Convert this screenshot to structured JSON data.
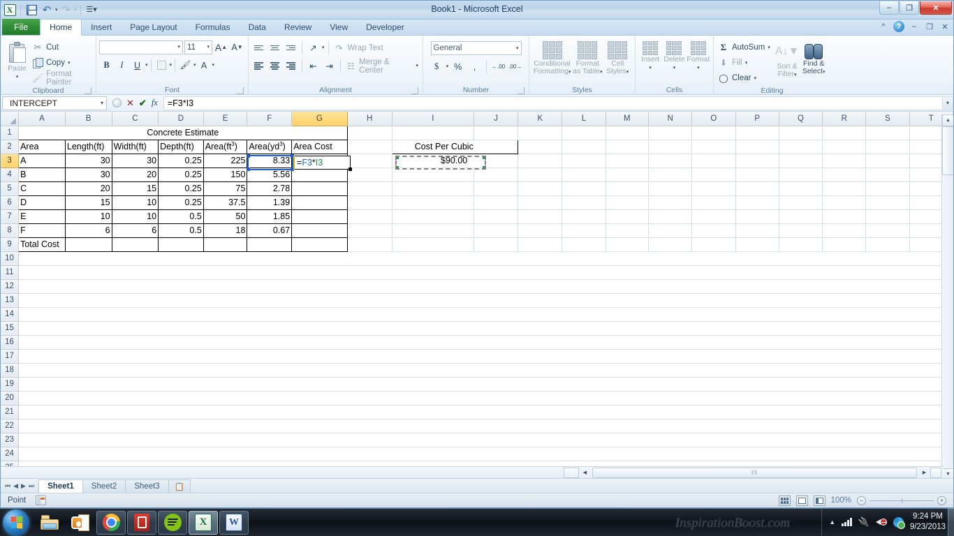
{
  "window": {
    "title": "Book1  -  Microsoft Excel",
    "minimize": "–",
    "restore": "❐",
    "close": "✕"
  },
  "qat": {
    "app_logo": "X",
    "save": "save-icon",
    "undo": "↶",
    "undo_caret": "▾",
    "redo": "↷",
    "redo_caret": "▾",
    "customize": "☰▾"
  },
  "ribbon": {
    "tabs": [
      {
        "label": "File",
        "active": false,
        "file": true
      },
      {
        "label": "Home",
        "active": true
      },
      {
        "label": "Insert",
        "active": false
      },
      {
        "label": "Page Layout",
        "active": false
      },
      {
        "label": "Formulas",
        "active": false
      },
      {
        "label": "Data",
        "active": false
      },
      {
        "label": "Review",
        "active": false
      },
      {
        "label": "View",
        "active": false
      },
      {
        "label": "Developer",
        "active": false
      }
    ],
    "collapse": "^",
    "help": "?",
    "min_ribbon": "–",
    "restore_ribbon": "❐",
    "close_ribbon": "✕",
    "groups": {
      "clipboard": {
        "label": "Clipboard",
        "paste": "Paste",
        "paste_caret": "▾",
        "cut": "Cut",
        "copy": "Copy",
        "copy_caret": "▾",
        "format_painter": "Format Painter"
      },
      "font": {
        "label": "Font",
        "font_name": "",
        "font_size": "11",
        "grow": "A",
        "shrink": "A",
        "bold": "B",
        "italic": "I",
        "underline": "U",
        "underline_caret": "▾",
        "borders_caret": "▾",
        "fill_caret": "▾",
        "fontcolor": "A",
        "fontcolor_caret": "▾"
      },
      "alignment": {
        "label": "Alignment",
        "wrap_text": "Wrap Text",
        "merge_center": "Merge & Center",
        "merge_caret": "▾",
        "orientation_caret": "▾"
      },
      "number": {
        "label": "Number",
        "format": "General",
        "format_caret": "▾",
        "currency": "$",
        "currency_caret": "▾",
        "percent": "%",
        "comma": ",",
        "increase_decimal": ".00",
        "decrease_decimal": ".00"
      },
      "styles": {
        "label": "Styles",
        "conditional_formatting": "Conditional\nFormatting",
        "conditional_formatting_l1": "Conditional",
        "conditional_formatting_l2": "Formatting",
        "format_as_table_l1": "Format",
        "format_as_table_l2": "as Table",
        "cell_styles_l1": "Cell",
        "cell_styles_l2": "Styles",
        "caret": "▾"
      },
      "cells": {
        "label": "Cells",
        "insert": "Insert",
        "delete": "Delete",
        "format": "Format",
        "caret": "▾"
      },
      "editing": {
        "label": "Editing",
        "autosum": "AutoSum",
        "autosum_sigma": "Σ",
        "fill": "Fill",
        "clear": "Clear",
        "caret": "▾",
        "sort_filter_l1": "Sort &",
        "sort_filter_l2": "Filter",
        "find_select_l1": "Find &",
        "find_select_l2": "Select"
      }
    }
  },
  "formula_bar": {
    "name_box": "INTERCEPT",
    "name_box_caret": "▾",
    "cancel": "✕",
    "enter": "✔",
    "insert_function": "fx",
    "formula": "=F3*I3",
    "expand": "▾"
  },
  "grid": {
    "columns": [
      "A",
      "B",
      "C",
      "D",
      "E",
      "F",
      "G",
      "H",
      "I",
      "J",
      "K",
      "L",
      "M",
      "N",
      "O",
      "P",
      "Q",
      "R",
      "S",
      "T"
    ],
    "selected_column": "G",
    "rows": [
      1,
      2,
      3,
      4,
      5,
      6,
      7,
      8,
      9,
      10,
      11,
      12,
      13,
      14,
      15,
      16,
      17,
      18,
      19,
      20,
      21,
      22,
      23,
      24,
      25
    ],
    "selected_row": 3,
    "title_cell": "Concrete Estimate",
    "headers": [
      "Area",
      "Length(ft)",
      "Width(ft)",
      "Depth(ft)",
      "Area(ft",
      "Area(yd",
      "Area Cost"
    ],
    "header_superscripts": {
      "area_ft": "3",
      "area_yd": "3"
    },
    "header_area_ft_prefix": "Area(ft",
    "header_area_ft_suffix": ")",
    "header_area_yd_prefix": "Area(yd",
    "header_area_yd_suffix": ")",
    "data_rows": [
      {
        "area": "A",
        "length": "30",
        "width": "30",
        "depth": "0.25",
        "area_ft3": "225",
        "area_yd3": "8.33",
        "cost": ""
      },
      {
        "area": "B",
        "length": "30",
        "width": "20",
        "depth": "0.25",
        "area_ft3": "150",
        "area_yd3": "5.56",
        "cost": ""
      },
      {
        "area": "C",
        "length": "20",
        "width": "15",
        "depth": "0.25",
        "area_ft3": "75",
        "area_yd3": "2.78",
        "cost": ""
      },
      {
        "area": "D",
        "length": "15",
        "width": "10",
        "depth": "0.25",
        "area_ft3": "37.5",
        "area_yd3": "1.39",
        "cost": ""
      },
      {
        "area": "E",
        "length": "10",
        "width": "10",
        "depth": "0.5",
        "area_ft3": "50",
        "area_yd3": "1.85",
        "cost": ""
      },
      {
        "area": "F",
        "length": "6",
        "width": "6",
        "depth": "0.5",
        "area_ft3": "18",
        "area_yd3": "0.67",
        "cost": ""
      }
    ],
    "total_row_label": "Total Cost",
    "side_table": {
      "header": "Cost Per Cubic Yard",
      "value": "$90.00"
    },
    "editing_cell": {
      "address": "G3",
      "text_prefix": "=",
      "ref1": "F3",
      "operator": "*",
      "ref2": "I3",
      "ref1_color": "#1f5fd0",
      "ref2_color": "#1e8f3c"
    }
  },
  "sheet_tabs": {
    "first": "⏮",
    "prev": "◀",
    "next": "▶",
    "last": "⏭",
    "tabs": [
      {
        "label": "Sheet1",
        "active": true
      },
      {
        "label": "Sheet2",
        "active": false
      },
      {
        "label": "Sheet3",
        "active": false
      }
    ],
    "insert_sheet": "insert-sheet-icon"
  },
  "status_bar": {
    "mode": "Point",
    "macro_record": "record-macro-icon",
    "view_normal": "normal-view-icon",
    "view_page_layout": "page-layout-view-icon",
    "view_page_break": "page-break-view-icon",
    "zoom": "100%",
    "zoom_out": "−",
    "zoom_in": "+"
  },
  "scrollbars": {
    "up": "▲",
    "down": "▼",
    "left": "◀",
    "right": "▶",
    "grip": "‖‖"
  },
  "taskbar": {
    "start": "windows-start-orb",
    "pinned": [
      {
        "name": "windows-explorer",
        "running": false
      },
      {
        "name": "microsoft-outlook",
        "running": false
      },
      {
        "name": "google-chrome",
        "running": true
      },
      {
        "name": "adobe-reader",
        "running": true
      },
      {
        "name": "spotify",
        "running": true
      },
      {
        "name": "microsoft-excel",
        "running": true,
        "active": true
      },
      {
        "name": "microsoft-word",
        "running": true
      }
    ],
    "watermark": "InspirationBoost.com",
    "tray": {
      "show_hidden": "▲",
      "network": "network-signal-icon",
      "unknown": "device-icon",
      "volume": "volume-muted-icon",
      "action_center": "action-center-icon",
      "time": "9:24 PM",
      "date": "9/23/2013"
    }
  },
  "colors": {
    "excel_green": "#1e7145",
    "selection_blue": "#1f5fd0",
    "ref_green": "#1e8f3c",
    "header_selected": "#ffd169"
  }
}
